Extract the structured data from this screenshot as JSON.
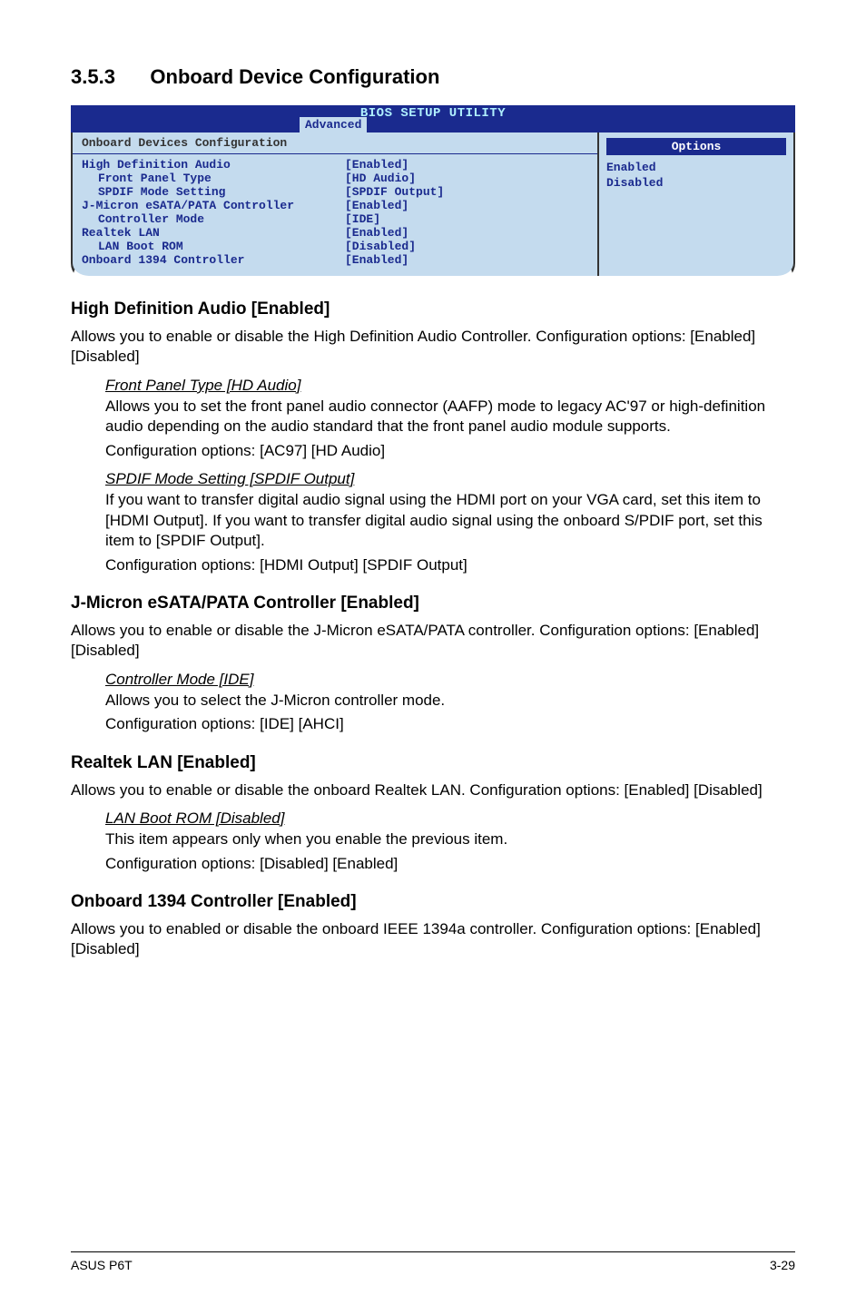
{
  "section": {
    "num": "3.5.3",
    "title": "Onboard Device Configuration"
  },
  "bios": {
    "title": "BIOS SETUP UTILITY",
    "tab": "Advanced",
    "panel_title": "Onboard Devices Configuration",
    "rows": [
      {
        "lbl": "High Definition Audio",
        "val": "[Enabled]",
        "indent": false
      },
      {
        "lbl": "Front Panel Type",
        "val": "[HD Audio]",
        "indent": true
      },
      {
        "lbl": "SPDIF Mode Setting",
        "val": "[SPDIF Output]",
        "indent": true
      },
      {
        "lbl": "J-Micron eSATA/PATA Controller",
        "val": "[Enabled]",
        "indent": false
      },
      {
        "lbl": "Controller Mode",
        "val": "[IDE]",
        "indent": true
      },
      {
        "lbl": "Realtek LAN",
        "val": "[Enabled]",
        "indent": false
      },
      {
        "lbl": "LAN Boot ROM",
        "val": "[Disabled]",
        "indent": true
      },
      {
        "lbl": "Onboard 1394 Controller",
        "val": "[Enabled]",
        "indent": false
      }
    ],
    "options_header": "Options",
    "options": [
      "Enabled",
      "Disabled"
    ]
  },
  "s1": {
    "h": "High Definition Audio [Enabled]",
    "p1": "Allows you to enable or disable the High Definition Audio Controller. Configuration options: [Enabled] [Disabled]",
    "sub1_h": "Front Panel Type [HD Audio]",
    "sub1_p": "Allows you to set the front panel audio connector (AAFP) mode to legacy AC'97 or high-definition audio depending on the audio standard that the front panel audio module supports.",
    "sub1_c": "Configuration options: [AC97] [HD Audio]",
    "sub2_h": "SPDIF Mode Setting [SPDIF Output]",
    "sub2_p": "If you want to transfer digital audio signal using the HDMI port on your VGA card, set this item to [HDMI Output]. If you want to transfer digital audio signal using the onboard S/PDIF port, set this item to [SPDIF Output].",
    "sub2_c": "Configuration options: [HDMI Output] [SPDIF Output]"
  },
  "s2": {
    "h": "J-Micron eSATA/PATA Controller [Enabled]",
    "p1": "Allows you to enable or disable the J-Micron eSATA/PATA controller. Configuration options: [Enabled] [Disabled]",
    "sub1_h": "Controller Mode [IDE]",
    "sub1_p": "Allows you to select the J-Micron controller mode.",
    "sub1_c": "Configuration options: [IDE] [AHCI]"
  },
  "s3": {
    "h": "Realtek LAN [Enabled]",
    "p1": "Allows you to enable or disable the onboard Realtek LAN. Configuration options: [Enabled] [Disabled]",
    "sub1_h": "LAN Boot ROM [Disabled]",
    "sub1_p": "This item appears only when you enable the previous item.",
    "sub1_c": "Configuration options: [Disabled] [Enabled]"
  },
  "s4": {
    "h": "Onboard 1394 Controller [Enabled]",
    "p1": "Allows you to enabled or disable the onboard IEEE 1394a controller. Configuration options: [Enabled] [Disabled]"
  },
  "footer": {
    "left": "ASUS P6T",
    "right": "3-29"
  }
}
